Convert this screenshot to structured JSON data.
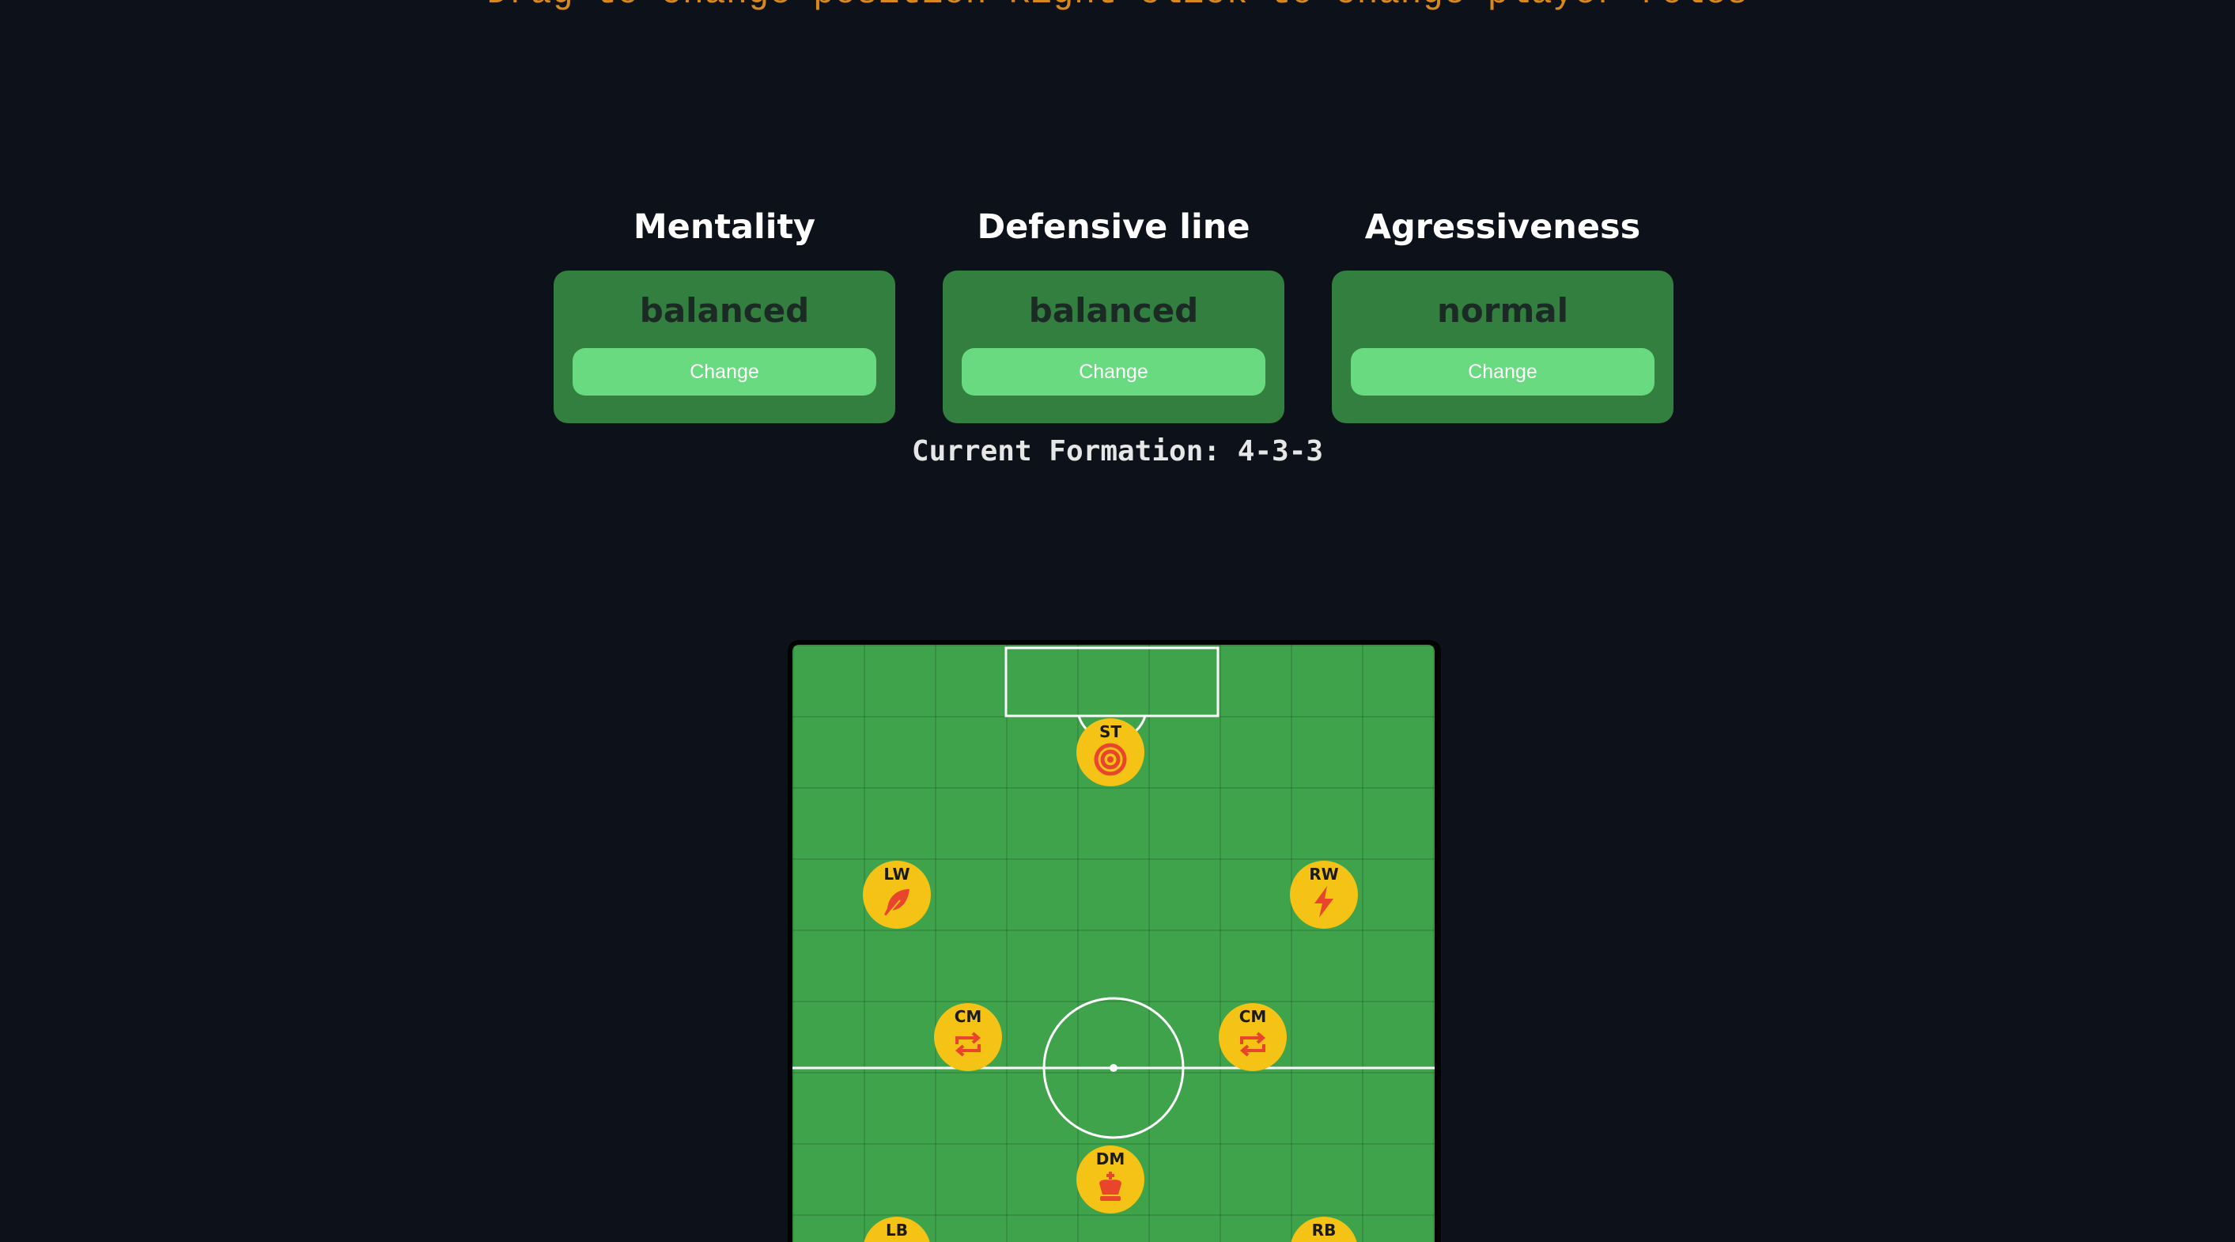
{
  "instructions": "Drag to change position Right click to change player roles",
  "tactics": [
    {
      "title": "Mentality",
      "value": "balanced",
      "button_label": "Change"
    },
    {
      "title": "Defensive line",
      "value": "balanced",
      "button_label": "Change"
    },
    {
      "title": "Agressiveness",
      "value": "normal",
      "button_label": "Change"
    }
  ],
  "formation": {
    "label": "Current Formation: 4-3-3"
  },
  "players": [
    {
      "position": "ST",
      "role_icon": "target-icon"
    },
    {
      "position": "LW",
      "role_icon": "feather-icon"
    },
    {
      "position": "RW",
      "role_icon": "lightning-icon"
    },
    {
      "position": "CM",
      "role_icon": "repeat-arrows-icon"
    },
    {
      "position": "CM",
      "role_icon": "repeat-arrows-icon"
    },
    {
      "position": "DM",
      "role_icon": "chess-king-icon"
    },
    {
      "position": "LB",
      "role_icon": "unknown"
    },
    {
      "position": "RB",
      "role_icon": "unknown"
    }
  ],
  "colors": {
    "background": "#0d111a",
    "instructions_text": "#d9891c",
    "card": "#337f3f",
    "button": "#69da80",
    "pitch": "#3ea34b",
    "player_token": "#f4c315",
    "role_icon": "#e8452c"
  }
}
